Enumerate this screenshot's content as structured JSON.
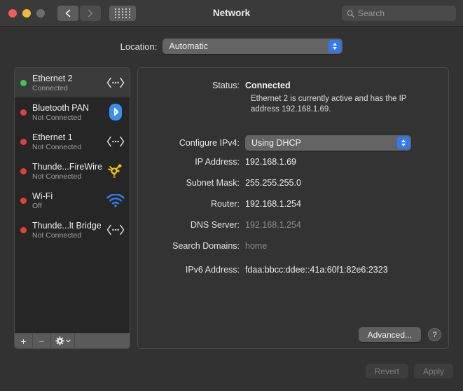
{
  "window": {
    "title": "Network",
    "traffic_lights": [
      "close",
      "minimize",
      "zoom"
    ]
  },
  "toolbar": {
    "back_icon": "chevron-left-icon",
    "forward_icon": "chevron-right-icon",
    "grid_icon": "all-preferences-grid-icon",
    "search": {
      "placeholder": "Search",
      "value": "",
      "icon": "search-icon"
    }
  },
  "location": {
    "label": "Location:",
    "selected": "Automatic"
  },
  "sidebar": {
    "services": [
      {
        "name": "Ethernet 2",
        "state": "Connected",
        "status": "connected",
        "icon": "ethernet-icon",
        "selected": true
      },
      {
        "name": "Bluetooth PAN",
        "state": "Not Connected",
        "status": "disconnected",
        "icon": "bluetooth-icon",
        "selected": false
      },
      {
        "name": "Ethernet 1",
        "state": "Not Connected",
        "status": "disconnected",
        "icon": "ethernet-icon",
        "selected": false
      },
      {
        "name": "Thunde...FireWire",
        "state": "Not Connected",
        "status": "disconnected",
        "icon": "firewire-icon",
        "selected": false
      },
      {
        "name": "Wi-Fi",
        "state": "Off",
        "status": "disconnected",
        "icon": "wifi-icon",
        "selected": false
      },
      {
        "name": "Thunde...lt Bridge",
        "state": "Not Connected",
        "status": "disconnected",
        "icon": "ethernet-icon",
        "selected": false
      }
    ],
    "tools": {
      "add": "+",
      "remove": "−",
      "gear": "gear-icon",
      "gear_chevron": "chevron-down-icon"
    }
  },
  "details": {
    "status": {
      "label": "Status:",
      "value": "Connected"
    },
    "description": "Ethernet 2 is currently active and has the IP address 192.168.1.69.",
    "configure_ipv4": {
      "label": "Configure IPv4:",
      "selected": "Using DHCP"
    },
    "ip_address": {
      "label": "IP Address:",
      "value": "192.168.1.69"
    },
    "subnet_mask": {
      "label": "Subnet Mask:",
      "value": "255.255.255.0"
    },
    "router": {
      "label": "Router:",
      "value": "192.168.1.254"
    },
    "dns_server": {
      "label": "DNS Server:",
      "value": "192.168.1.254"
    },
    "search_domains": {
      "label": "Search Domains:",
      "value": "home"
    },
    "ipv6_address": {
      "label": "IPv6 Address:",
      "value": "fdaa:bbcc:ddee::41a:60f1:82e6:2323"
    },
    "advanced_button": "Advanced...",
    "help_button": "?"
  },
  "footer": {
    "revert": "Revert",
    "apply": "Apply"
  },
  "colors": {
    "accent_blue": "#3478f6",
    "status_connected": "#43c54a",
    "status_disconnected": "#e2403a",
    "bluetooth_blue": "#3b8eea",
    "firewire_yellow": "#f2c50a",
    "wifi_blue": "#2f7fe0",
    "window_bg": "#323232",
    "panel_bg": "#333333",
    "sidebar_bg": "#262626"
  }
}
